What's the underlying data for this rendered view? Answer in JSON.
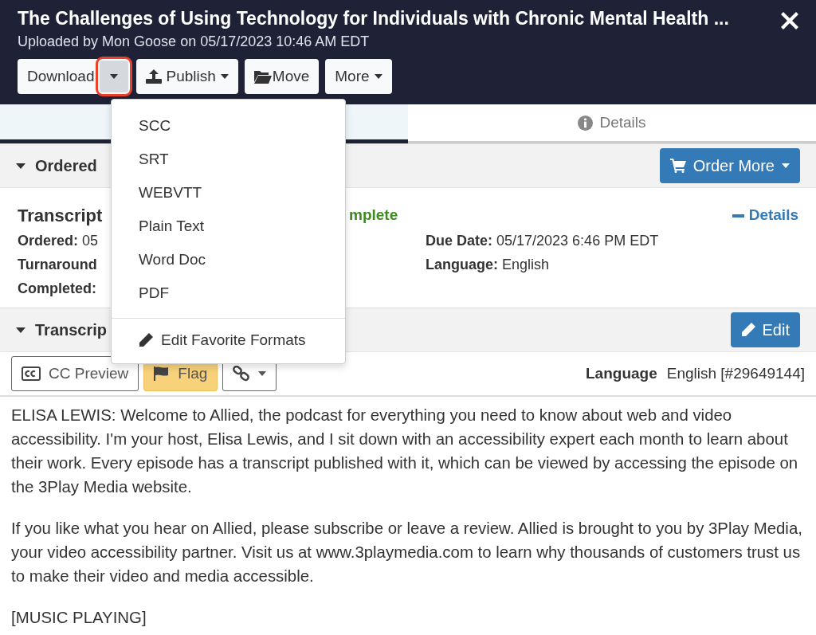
{
  "header": {
    "title": "The Challenges of Using Technology for Individuals with Chronic Mental Health ...",
    "subtitle": "Uploaded by Mon Goose on 05/17/2023 10:46 AM EDT"
  },
  "actions": [
    {
      "label": "Download",
      "kind": "split",
      "highlighted": true
    },
    {
      "label": "Publish",
      "kind": "upload"
    },
    {
      "label": "Move",
      "kind": "folder"
    },
    {
      "label": "More",
      "kind": "menu"
    }
  ],
  "download_menu": [
    {
      "label": "SCC",
      "kind": "format"
    },
    {
      "label": "SRT",
      "kind": "format"
    },
    {
      "label": "WEBVTT",
      "kind": "format"
    },
    {
      "label": "Plain Text",
      "kind": "format"
    },
    {
      "label": "Word Doc",
      "kind": "format"
    },
    {
      "label": "PDF",
      "kind": "format"
    },
    {
      "label": "Edit Favorite Formats",
      "kind": "edit"
    }
  ],
  "tabs": [
    {
      "selected": true
    },
    {
      "label": "Details",
      "selected": false
    }
  ],
  "ordered_section": {
    "heading": "Ordered",
    "expanded": true,
    "button": "Order More"
  },
  "service": {
    "name": "Transcript",
    "status": "mplete",
    "details_link": "Details",
    "left_fields": [
      {
        "label": "Ordered:",
        "value": "05"
      },
      {
        "label": "Turnaround"
      },
      {
        "label": "Completed:"
      }
    ],
    "right_fields": [
      {
        "label": "Due Date:",
        "value": "05/17/2023 6:46 PM EDT"
      },
      {
        "label": "Language:",
        "value": "English"
      }
    ]
  },
  "transcript_section": {
    "heading": "Transcrip",
    "expanded": true,
    "button": "Edit"
  },
  "transcript_tools": {
    "cc_preview": "CC Preview",
    "flag": "Flag",
    "language_label": "Language",
    "language_value": "English [#29649144]"
  },
  "paragraphs": [
    "ELISA LEWIS: Welcome to Allied, the podcast for everything you need to know about web and video accessibility. I'm your host, Elisa Lewis, and I sit down with an accessibility expert each month to learn about their work. Every episode has a transcript published with it, which can be viewed by accessing the episode on the 3Play Media website.",
    "If you like what you hear on Allied, please subscribe or leave a review. Allied is brought to you by 3Play Media, your video accessibility partner. Visit us at www.3playmedia.com to learn why thousands of customers trust us to make their video and media accessible.",
    "[MUSIC PLAYING]"
  ]
}
